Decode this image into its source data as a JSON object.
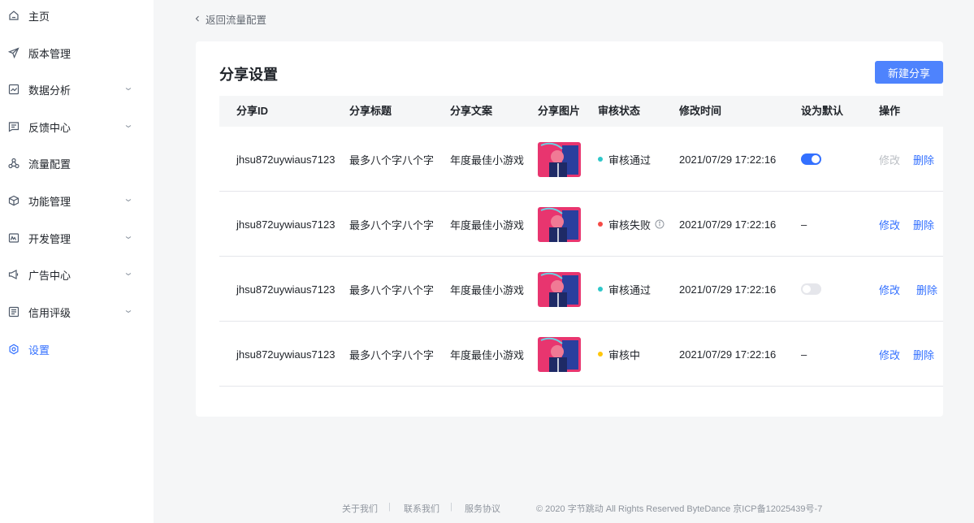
{
  "sidebar": {
    "items": [
      {
        "label": "主页",
        "icon": "home-icon",
        "expandable": false,
        "active": false
      },
      {
        "label": "版本管理",
        "icon": "send-icon",
        "expandable": false,
        "active": false
      },
      {
        "label": "数据分析",
        "icon": "chart-icon",
        "expandable": true,
        "active": false
      },
      {
        "label": "反馈中心",
        "icon": "message-icon",
        "expandable": true,
        "active": false
      },
      {
        "label": "流量配置",
        "icon": "share-icon",
        "expandable": false,
        "active": false
      },
      {
        "label": "功能管理",
        "icon": "cube-icon",
        "expandable": true,
        "active": false
      },
      {
        "label": "开发管理",
        "icon": "code-icon",
        "expandable": true,
        "active": false
      },
      {
        "label": "广告中心",
        "icon": "megaphone-icon",
        "expandable": true,
        "active": false
      },
      {
        "label": "信用评级",
        "icon": "list-icon",
        "expandable": true,
        "active": false
      },
      {
        "label": "设置",
        "icon": "gear-icon",
        "expandable": false,
        "active": true
      }
    ]
  },
  "back_link": "返回流量配置",
  "card": {
    "title": "分享设置",
    "new_button": "新建分享"
  },
  "table": {
    "columns": [
      "分享ID",
      "分享标题",
      "分享文案",
      "分享图片",
      "审核状态",
      "修改时间",
      "设为默认",
      "操作"
    ],
    "rows": [
      {
        "id": "jhsu872uywiaus7123",
        "title": "最多八个字八个字",
        "copy": "年度最佳小游戏",
        "status": "审核通过",
        "status_color": "#2ec7c9",
        "status_info": false,
        "time": "2021/07/29 17:22:16",
        "default": "on",
        "default_text": "",
        "edit": "修改",
        "edit_disabled": true,
        "delete": "删除"
      },
      {
        "id": "jhsu872uywiaus7123",
        "title": "最多八个字八个字",
        "copy": "年度最佳小游戏",
        "status": "审核失败",
        "status_color": "#f54a45",
        "status_info": true,
        "time": "2021/07/29 17:22:16",
        "default": "none",
        "default_text": "–",
        "edit": "修改",
        "edit_disabled": false,
        "delete": "删除"
      },
      {
        "id": "jhsu872uywiaus7123",
        "title": "最多八个字八个字",
        "copy": "年度最佳小游戏",
        "status": "审核通过",
        "status_color": "#2ec7c9",
        "status_info": false,
        "time": "2021/07/29 17:22:16",
        "default": "off",
        "default_text": "",
        "edit": "修改",
        "edit_disabled": false,
        "delete": "删除"
      },
      {
        "id": "jhsu872uywiaus7123",
        "title": "最多八个字八个字",
        "copy": "年度最佳小游戏",
        "status": "审核中",
        "status_color": "#ffc60a",
        "status_info": false,
        "time": "2021/07/29 17:22:16",
        "default": "none",
        "default_text": "–",
        "edit": "修改",
        "edit_disabled": false,
        "delete": "删除"
      }
    ]
  },
  "footer": {
    "about": "关于我们",
    "contact": "联系我们",
    "terms": "服务协议",
    "separator": "|",
    "copyright": "© 2020 字节跳动 All Rights Reserved ByteDance 京ICP备12025439号-7"
  },
  "colors": {
    "accent": "#3370ff",
    "button": "#4e83fd"
  }
}
